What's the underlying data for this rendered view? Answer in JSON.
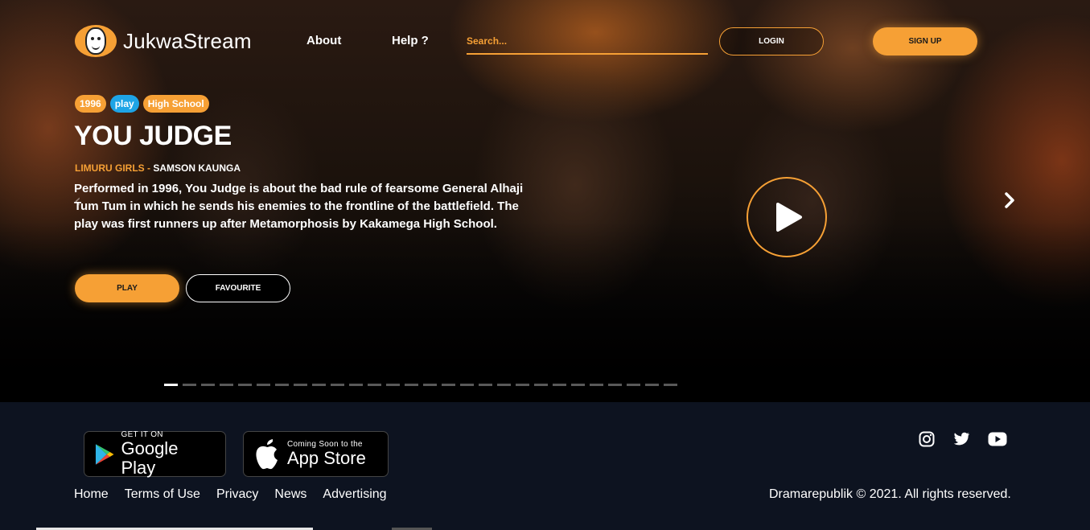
{
  "header": {
    "brand": "JukwaStream",
    "nav": {
      "about": "About",
      "help": "Help ?"
    },
    "search_placeholder": "Search...",
    "login": "LOGIN",
    "signup": "SIGN UP"
  },
  "hero": {
    "tags": {
      "year": "1996",
      "category": "play",
      "level": "High School"
    },
    "title": "YOU JUDGE",
    "school": "LIMURU GIRLS",
    "separator": " - ",
    "author": "SAMSON KAUNGA",
    "description": "Performed in 1996, You Judge is about the bad rule of fearsome General Alhaji Tum Tum in which he sends his enemies to the frontline of the battlefield. The play was first runners up after Metamorphosis by Kakamega High School.",
    "play_button": "PLAY",
    "favourite_button": "FAVOURITE",
    "slide_count": 28,
    "active_slide": 1
  },
  "footer": {
    "google_play": {
      "small": "GET IT ON",
      "big": "Google Play"
    },
    "app_store": {
      "small": "Coming Soon to the",
      "big": "App Store"
    },
    "links": {
      "home": "Home",
      "terms": "Terms of Use",
      "privacy": "Privacy",
      "news": "News",
      "advertising": "Advertising"
    },
    "copyright": "Dramarepublik © 2021. All rights reserved.",
    "social_icons": [
      "instagram-icon",
      "twitter-icon",
      "youtube-icon"
    ]
  },
  "colors": {
    "accent": "#f6a035",
    "tag_blue": "#1ea4e6",
    "footer_bg": "#0d1320"
  }
}
